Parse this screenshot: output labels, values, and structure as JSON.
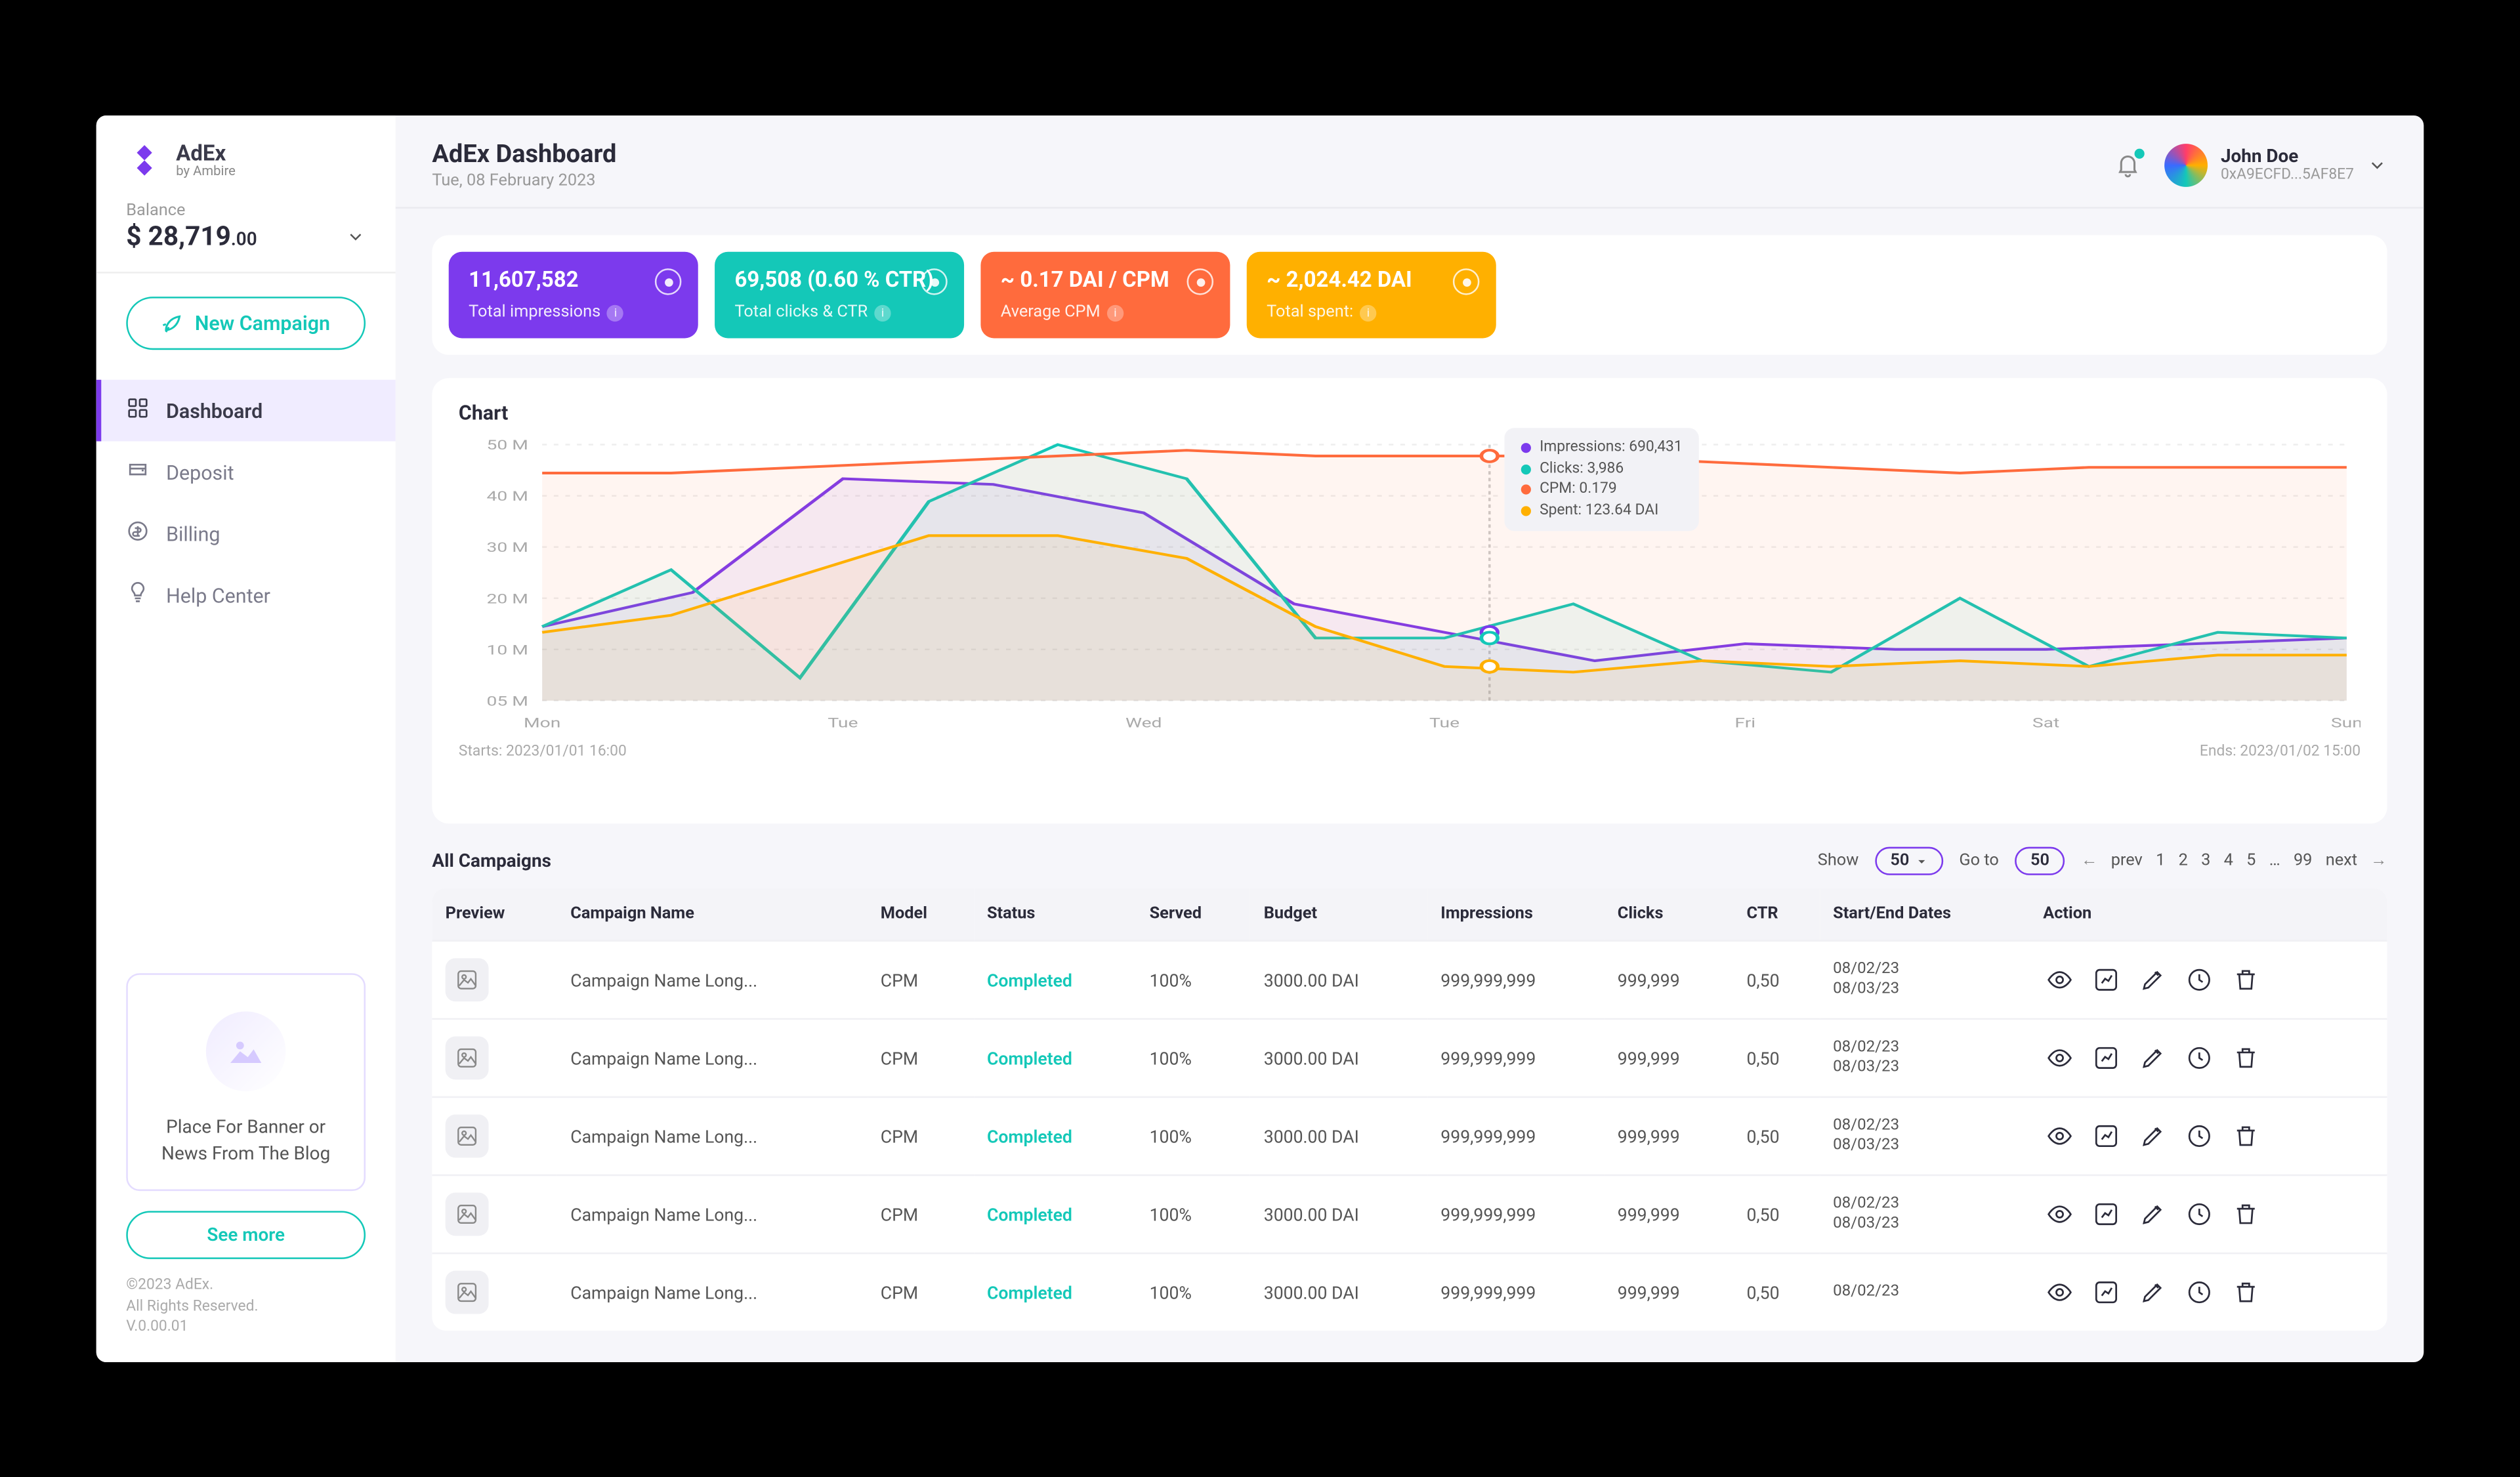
{
  "brand": {
    "name": "AdEx",
    "tagline": "by Ambire"
  },
  "balance": {
    "label": "Balance",
    "amount": "$ 28,719",
    "cents": ".00"
  },
  "new_campaign": "New Campaign",
  "nav": [
    {
      "key": "dashboard",
      "label": "Dashboard",
      "active": true
    },
    {
      "key": "deposit",
      "label": "Deposit"
    },
    {
      "key": "billing",
      "label": "Billing"
    },
    {
      "key": "help",
      "label": "Help Center"
    }
  ],
  "promo": {
    "text": "Place For Banner or News From The Blog",
    "cta": "See more"
  },
  "footer": {
    "copyright": "©2023 AdEx.",
    "rights": "All Rights Reserved.",
    "version": "V.0.00.01"
  },
  "header": {
    "title": "AdEx Dashboard",
    "date": "Tue, 08 February 2023"
  },
  "user": {
    "name": "John Doe",
    "address": "0xA9ECFD...5AF8E7"
  },
  "cards": [
    {
      "value": "11,607,582",
      "label": "Total impressions",
      "cls": "p"
    },
    {
      "value": "69,508 (0.60 % CTR)",
      "label": "Total clicks & CTR",
      "cls": "t"
    },
    {
      "value": "~ 0.17 DAI / CPM",
      "label": "Average CPM",
      "cls": "o"
    },
    {
      "value": "~ 2,024.42 DAI",
      "label": "Total spent:",
      "cls": "y"
    }
  ],
  "chart": {
    "title": "Chart",
    "tooltip": {
      "impressions": "Impressions: 690,431",
      "clicks": "Clicks: 3,986",
      "cpm": "CPM: 0.179",
      "spent": "Spent: 123.64 DAI"
    },
    "starts": "Starts: 2023/01/01 16:00",
    "ends": "Ends: 2023/01/02 15:00"
  },
  "chart_data": {
    "type": "line",
    "ylabel": "",
    "ylim": [
      5,
      50
    ],
    "yticks": [
      "50 M",
      "40 M",
      "30 M",
      "20 M",
      "10 M",
      "05 M"
    ],
    "categories": [
      "Mon",
      "Tue",
      "Wed",
      "Tue",
      "Fri",
      "Sat",
      "Sun"
    ],
    "series": [
      {
        "name": "Impressions",
        "color": "#7c3aed",
        "values": [
          18,
          24,
          44,
          43,
          38,
          22,
          17,
          12,
          15,
          14,
          14,
          15,
          16
        ]
      },
      {
        "name": "Clicks",
        "color": "#14c8b8",
        "values": [
          18,
          28,
          9,
          40,
          50,
          44,
          16,
          16,
          22,
          12,
          10,
          23,
          11,
          17,
          16
        ]
      },
      {
        "name": "CPM",
        "color": "#ff6b3d",
        "values": [
          45,
          45,
          46,
          47,
          48,
          49,
          48,
          48,
          48,
          47,
          46,
          45,
          46,
          46,
          46
        ]
      },
      {
        "name": "Spent",
        "color": "#ffb000",
        "values": [
          17,
          20,
          27,
          34,
          34,
          30,
          18,
          11,
          10,
          12,
          11,
          12,
          11,
          13,
          13
        ]
      }
    ]
  },
  "table": {
    "title": "All Campaigns",
    "show_label": "Show",
    "show_value": "50",
    "goto_label": "Go to",
    "goto_value": "50",
    "prev": "prev",
    "next": "next",
    "pages": [
      "1",
      "2",
      "3",
      "4",
      "5",
      "…",
      "99"
    ],
    "columns": [
      "Preview",
      "Campaign Name",
      "Model",
      "Status",
      "Served",
      "Budget",
      "Impressions",
      "Clicks",
      "CTR",
      "Start/End Dates",
      "Action"
    ],
    "rows": [
      {
        "name": "Campaign Name Long...",
        "model": "CPM",
        "status": "Completed",
        "served": "100%",
        "budget": "3000.00 DAI",
        "impr": "999,999,999",
        "clicks": "999,999",
        "ctr": "0,50",
        "date1": "08/02/23",
        "date2": "08/03/23"
      },
      {
        "name": "Campaign Name Long...",
        "model": "CPM",
        "status": "Completed",
        "served": "100%",
        "budget": "3000.00 DAI",
        "impr": "999,999,999",
        "clicks": "999,999",
        "ctr": "0,50",
        "date1": "08/02/23",
        "date2": "08/03/23"
      },
      {
        "name": "Campaign Name Long...",
        "model": "CPM",
        "status": "Completed",
        "served": "100%",
        "budget": "3000.00 DAI",
        "impr": "999,999,999",
        "clicks": "999,999",
        "ctr": "0,50",
        "date1": "08/02/23",
        "date2": "08/03/23"
      },
      {
        "name": "Campaign Name Long...",
        "model": "CPM",
        "status": "Completed",
        "served": "100%",
        "budget": "3000.00 DAI",
        "impr": "999,999,999",
        "clicks": "999,999",
        "ctr": "0,50",
        "date1": "08/02/23",
        "date2": "08/03/23"
      },
      {
        "name": "Campaign Name Long...",
        "model": "CPM",
        "status": "Completed",
        "served": "100%",
        "budget": "3000.00 DAI",
        "impr": "999,999,999",
        "clicks": "999,999",
        "ctr": "0,50",
        "date1": "08/02/23",
        "date2": ""
      }
    ]
  }
}
